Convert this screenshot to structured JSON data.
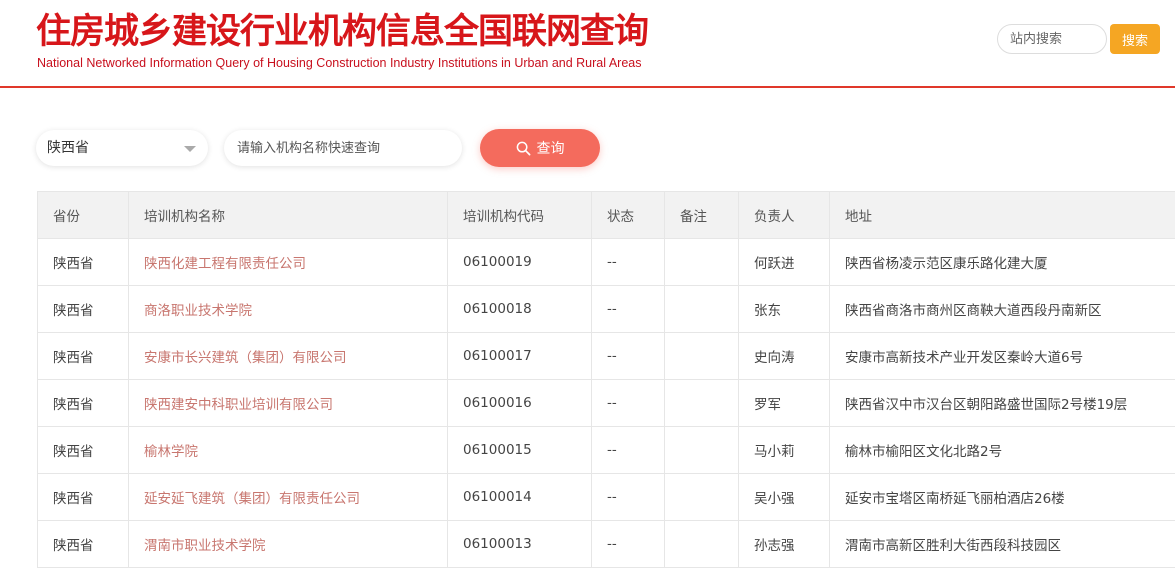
{
  "header": {
    "title_cn": "住房城乡建设行业机构信息全国联网查询",
    "title_en": "National Networked Information Query of Housing Construction Industry Institutions in Urban and Rural Areas",
    "site_search_placeholder": "站内搜索",
    "site_search_button": "搜索"
  },
  "filters": {
    "province": "陕西省",
    "name_placeholder": "请输入机构名称快速查询",
    "query_button": "查询"
  },
  "table": {
    "columns": [
      "省份",
      "培训机构名称",
      "培训机构代码",
      "状态",
      "备注",
      "负责人",
      "地址"
    ],
    "rows": [
      {
        "province": "陕西省",
        "name": "陕西化建工程有限责任公司",
        "code": "06100019",
        "status": "--",
        "note": "",
        "manager": "何跃进",
        "address": "陕西省杨凌示范区康乐路化建大厦"
      },
      {
        "province": "陕西省",
        "name": "商洛职业技术学院",
        "code": "06100018",
        "status": "--",
        "note": "",
        "manager": "张东",
        "address": "陕西省商洛市商州区商鞅大道西段丹南新区"
      },
      {
        "province": "陕西省",
        "name": "安康市长兴建筑（集团）有限公司",
        "code": "06100017",
        "status": "--",
        "note": "",
        "manager": "史向涛",
        "address": "安康市高新技术产业开发区秦岭大道6号"
      },
      {
        "province": "陕西省",
        "name": "陕西建安中科职业培训有限公司",
        "code": "06100016",
        "status": "--",
        "note": "",
        "manager": "罗军",
        "address": "陕西省汉中市汉台区朝阳路盛世国际2号楼19层"
      },
      {
        "province": "陕西省",
        "name": "榆林学院",
        "code": "06100015",
        "status": "--",
        "note": "",
        "manager": "马小莉",
        "address": "榆林市榆阳区文化北路2号"
      },
      {
        "province": "陕西省",
        "name": "延安延飞建筑（集团）有限责任公司",
        "code": "06100014",
        "status": "--",
        "note": "",
        "manager": "吴小强",
        "address": "延安市宝塔区南桥延飞丽柏酒店26楼"
      },
      {
        "province": "陕西省",
        "name": "渭南市职业技术学院",
        "code": "06100013",
        "status": "--",
        "note": "",
        "manager": "孙志强",
        "address": "渭南市高新区胜利大街西段科技园区"
      }
    ]
  },
  "colors": {
    "brand_red": "#d7161a",
    "query_button": "#f46b5d",
    "search_button": "#f5a623",
    "link_text": "#c8766f"
  }
}
